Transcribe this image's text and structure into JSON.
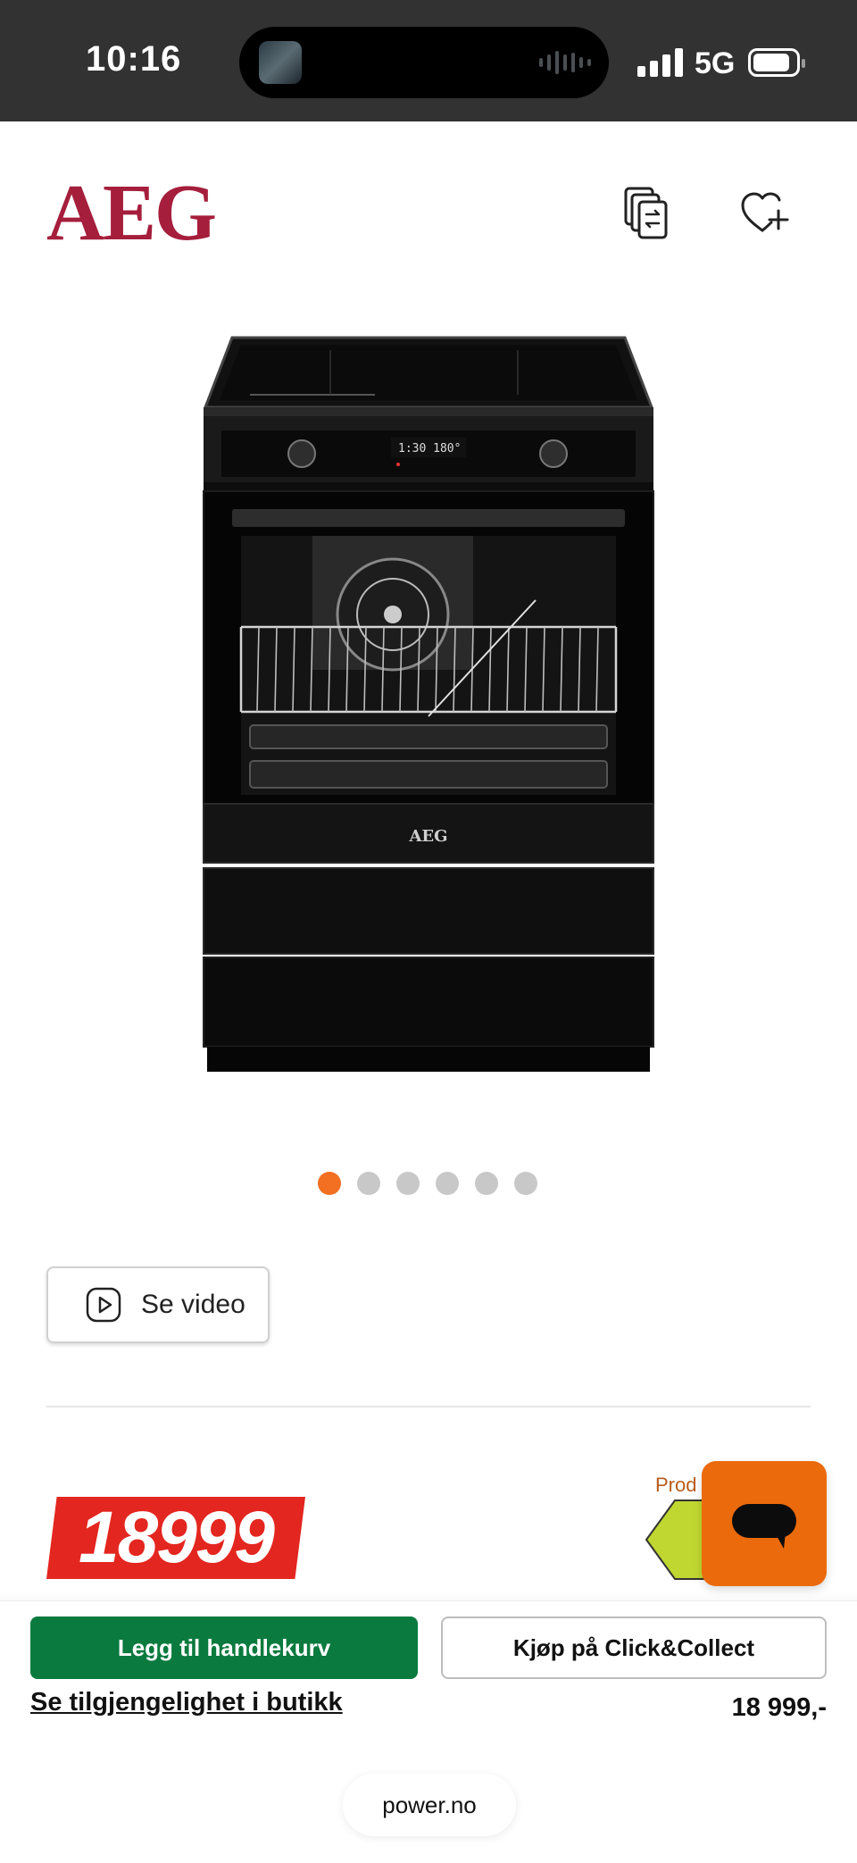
{
  "status_bar": {
    "time": "10:16",
    "network": "5G",
    "icons": [
      "signal-icon",
      "battery-icon",
      "live-activity-icon"
    ]
  },
  "header": {
    "brand": "AEG",
    "brand_color": "#a51e3c",
    "icons": [
      "compare-icon",
      "wishlist-add-icon"
    ]
  },
  "product": {
    "image_brand": "AEG",
    "carousel": {
      "count": 6,
      "active_index": 0,
      "active_color": "#f36f21"
    },
    "video_button_label": "Se video",
    "price": "18999",
    "price_color": "#e3261f",
    "energy_caption": "Prod",
    "energy_color": "#bfd730"
  },
  "chat": {
    "color": "#eb6a0b",
    "icon": "chat-icon"
  },
  "actions": {
    "cart_label": "Legg til handlekurv",
    "cart_color": "#0a7a3e",
    "collect_label": "Kjøp på Click&Collect",
    "store_link": "Se tilgjengelighet i butikk",
    "price_formatted": "18 999,-"
  },
  "browser": {
    "url": "power.no"
  }
}
